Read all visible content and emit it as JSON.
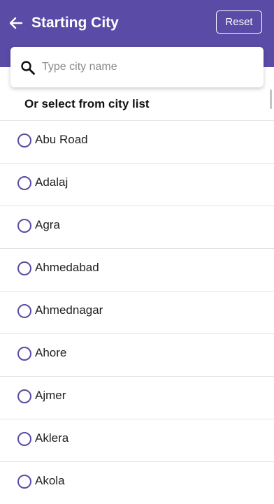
{
  "header": {
    "title": "Starting City",
    "reset_label": "Reset",
    "bg_color": "#5a4ba6"
  },
  "search": {
    "placeholder": "Type city name",
    "value": "",
    "icon": "search-icon"
  },
  "section_heading": "Or select from city list",
  "cities": [
    {
      "label": "Abu Road"
    },
    {
      "label": "Adalaj"
    },
    {
      "label": "Agra"
    },
    {
      "label": "Ahmedabad"
    },
    {
      "label": "Ahmednagar"
    },
    {
      "label": "Ahore"
    },
    {
      "label": "Ajmer"
    },
    {
      "label": "Aklera"
    },
    {
      "label": "Akola"
    }
  ],
  "accent_color": "#5a4ba6"
}
